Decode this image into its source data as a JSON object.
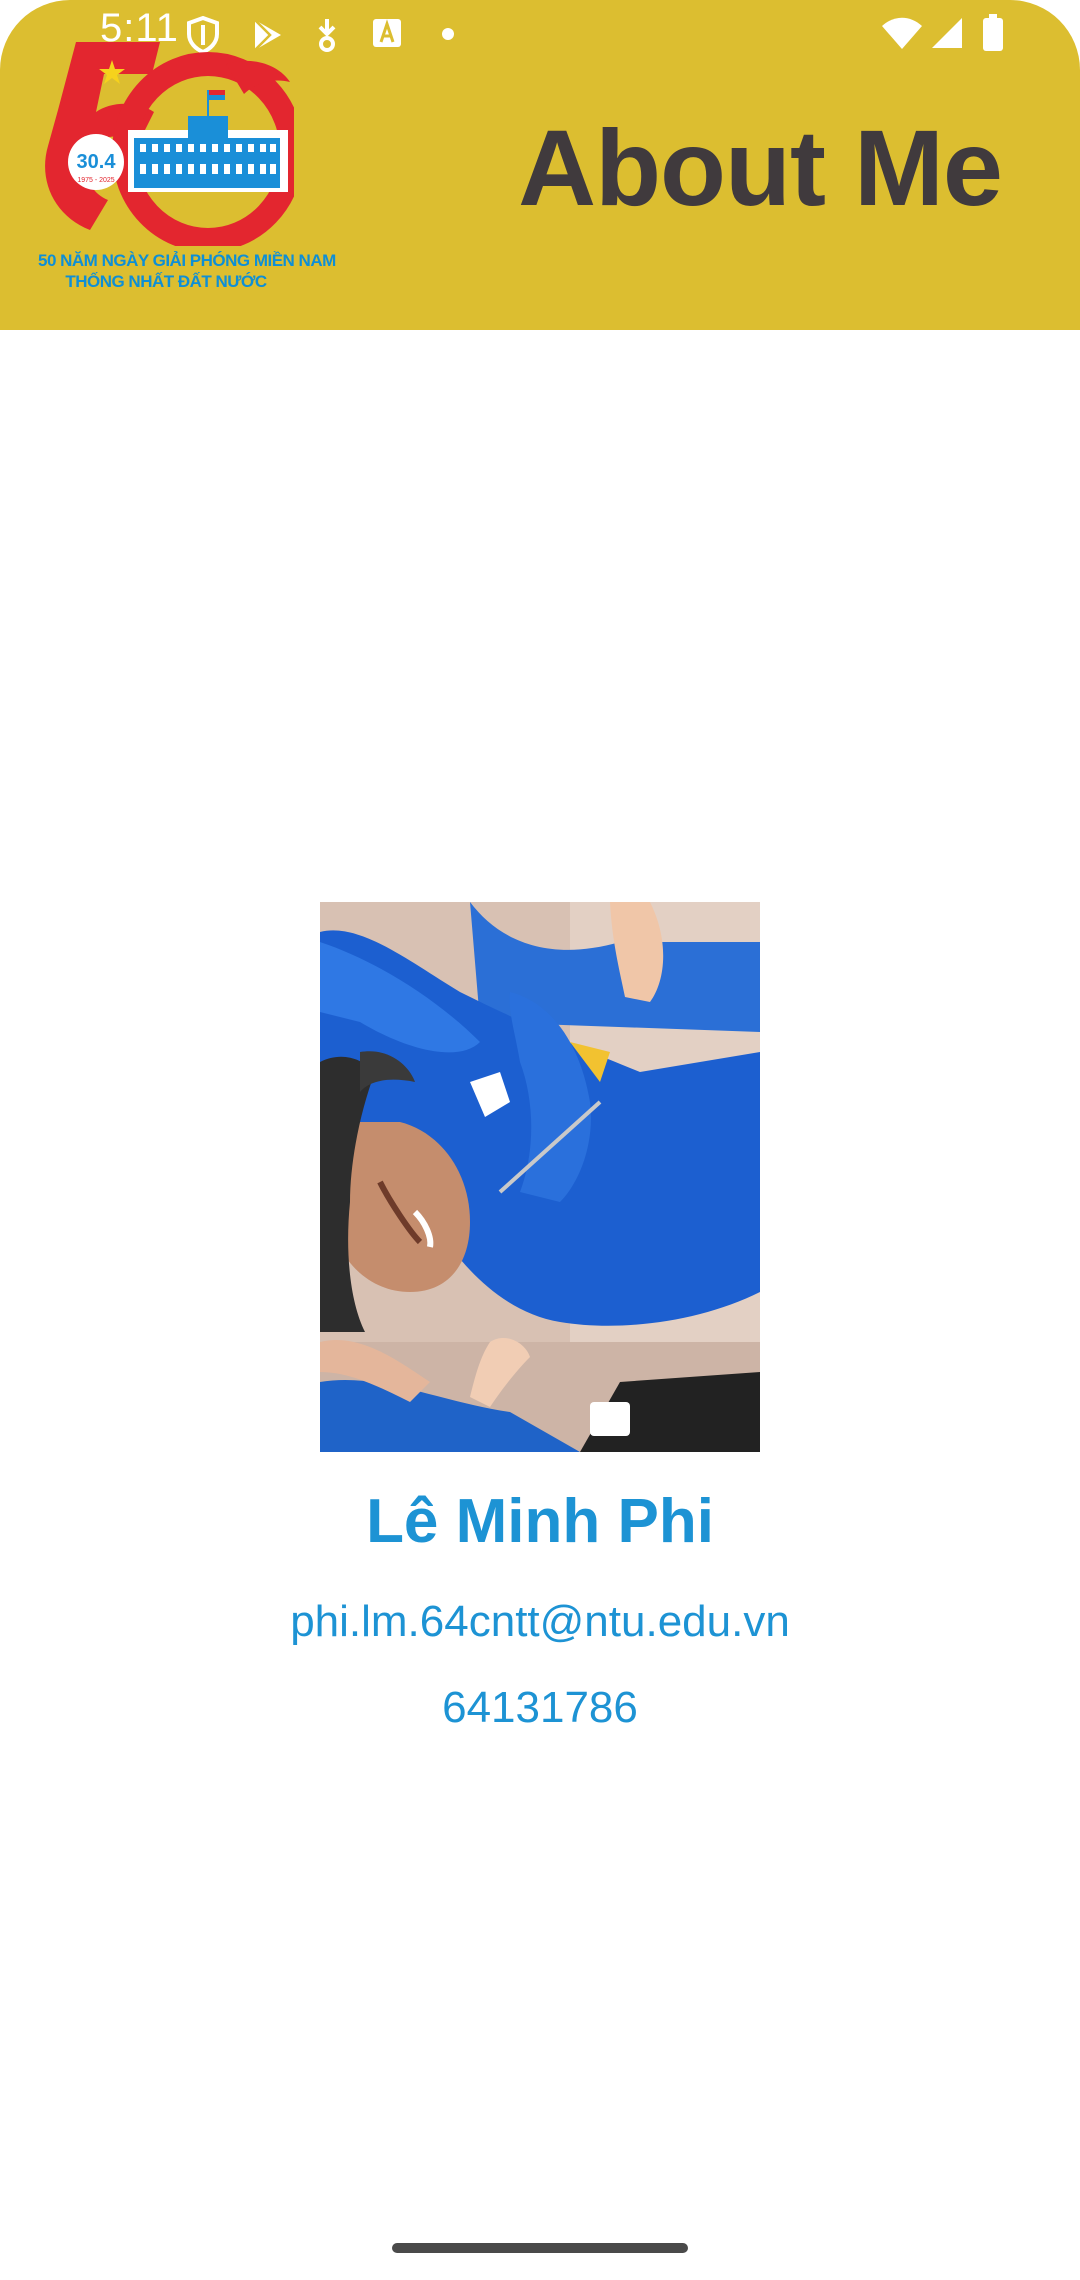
{
  "status_bar": {
    "time": "5:11",
    "icons": [
      "vpn-shield-icon",
      "play-store-icon",
      "download-icon",
      "text-a-icon",
      "notification-dot-icon",
      "wifi-icon",
      "signal-icon",
      "battery-icon"
    ]
  },
  "header": {
    "title": "About Me",
    "background_color": "#dcbe30",
    "logo": {
      "icon": "anniversary-50-logo",
      "number": "50",
      "date": "30.4",
      "years": "1975 - 2025",
      "caption_line1": "50 NĂM NGÀY GIẢI PHÓNG MIỀN NAM",
      "caption_line2": "THỐNG NHẤT ĐẤT NƯỚC"
    }
  },
  "profile": {
    "photo_icon": "profile-photo",
    "name": "Lê Minh Phi",
    "email": "phi.lm.64cntt@ntu.edu.vn",
    "student_id": "64131786",
    "text_color": "#1d93d4"
  }
}
